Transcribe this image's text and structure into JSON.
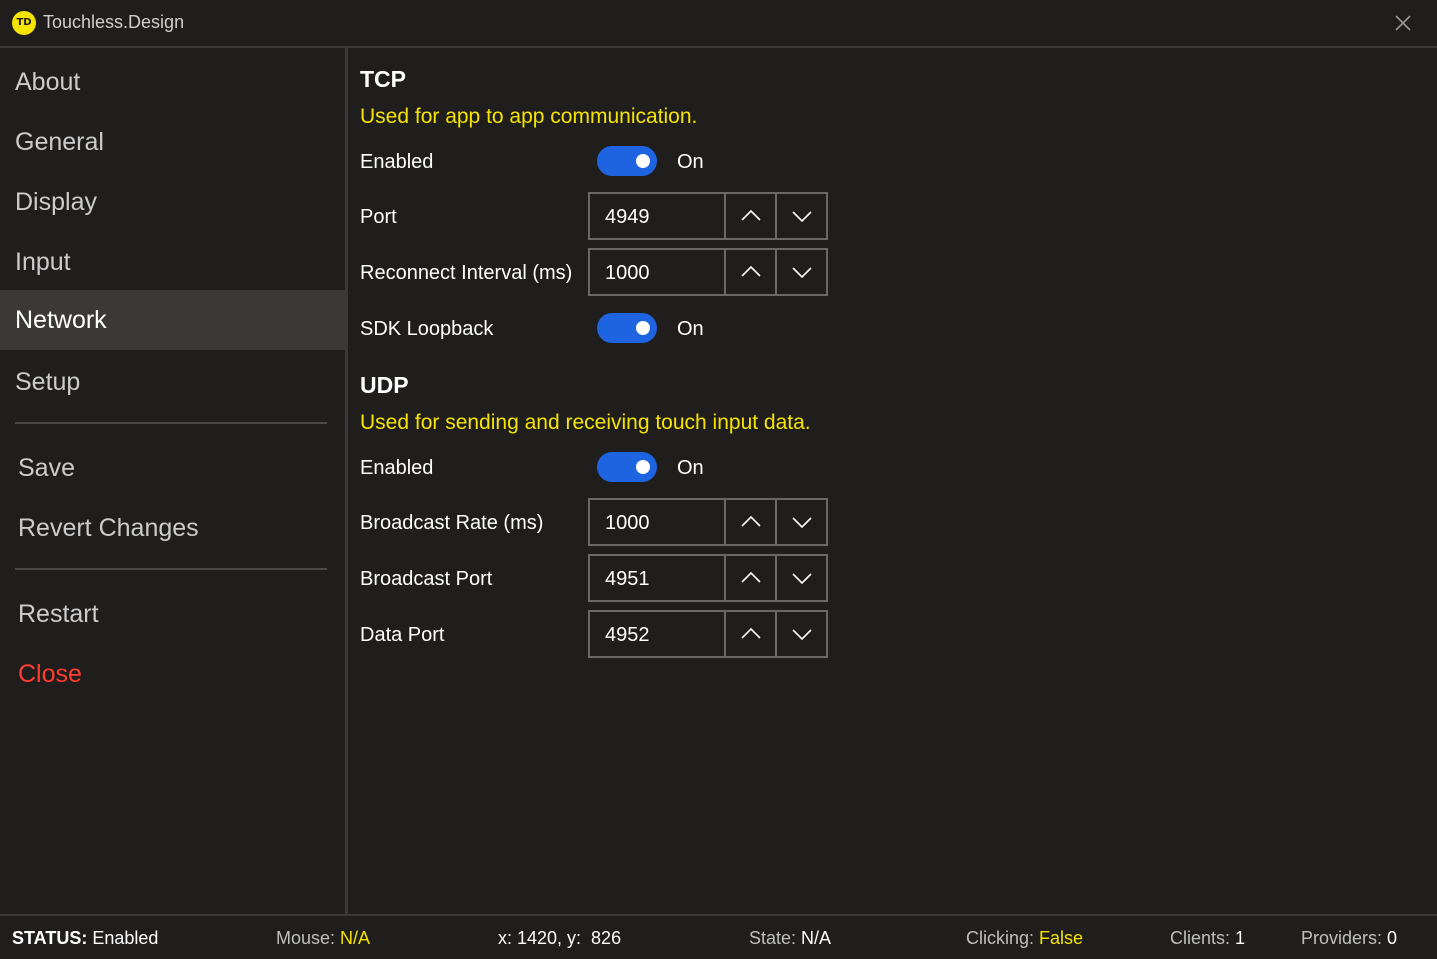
{
  "window": {
    "logo_text": "TD",
    "title": "Touchless.Design",
    "close_icon": "close-icon"
  },
  "sidebar": {
    "items": [
      {
        "label": "About"
      },
      {
        "label": "General"
      },
      {
        "label": "Display"
      },
      {
        "label": "Input"
      },
      {
        "label": "Network",
        "active": true
      },
      {
        "label": "Setup"
      }
    ],
    "actions": {
      "save": "Save",
      "revert": "Revert Changes",
      "restart": "Restart",
      "close": "Close"
    }
  },
  "tcp": {
    "title": "TCP",
    "description": "Used for app to app communication.",
    "enabled": {
      "label": "Enabled",
      "state": "On"
    },
    "port": {
      "label": "Port",
      "value": "4949"
    },
    "reconnect_interval": {
      "label": "Reconnect Interval (ms)",
      "value": "1000"
    },
    "sdk_loopback": {
      "label": "SDK Loopback",
      "state": "On"
    }
  },
  "udp": {
    "title": "UDP",
    "description": "Used for sending and receiving touch input data.",
    "enabled": {
      "label": "Enabled",
      "state": "On"
    },
    "broadcast_rate": {
      "label": "Broadcast Rate (ms)",
      "value": "1000"
    },
    "broadcast_port": {
      "label": "Broadcast Port",
      "value": "4951"
    },
    "data_port": {
      "label": "Data Port",
      "value": "4952"
    }
  },
  "status": {
    "status_label": "STATUS:",
    "status_value": "Enabled",
    "mouse_label": "Mouse:",
    "mouse_value": "N/A",
    "coords": "x: 1420, y:  826",
    "state_label": "State:",
    "state_value": "N/A",
    "clicking_label": "Clicking:",
    "clicking_value": "False",
    "clients_label": "Clients:",
    "clients_value": "1",
    "providers_label": "Providers:",
    "providers_value": "0"
  },
  "colors": {
    "background": "#1f1e1d",
    "accent_blue": "#1e63e0",
    "highlight_yellow": "#f5e400",
    "danger_red": "#ff3b30",
    "active_nav": "#3a3938"
  }
}
